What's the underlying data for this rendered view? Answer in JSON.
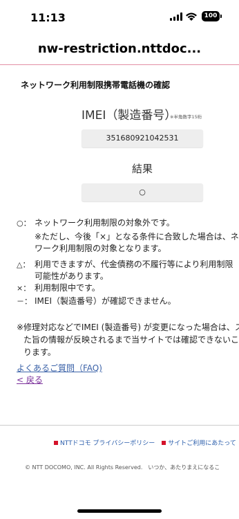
{
  "status": {
    "time": "11:13",
    "battery": "100"
  },
  "browser": {
    "url": "nw-restriction.nttdoc..."
  },
  "page": {
    "heading": "ネットワーク利用制限携帯電話機の確認",
    "imei_label": "IMEI（製造番号）",
    "imei_note": "※半角数字15桁",
    "imei_value": "351680921042531",
    "result_label": "結果",
    "result_value": "○"
  },
  "legend": {
    "circle_mark": "○：",
    "circle_text": "ネットワーク利用制限の対象外です。",
    "circle_note_1": "※ただし、今後「×」となる条件に合致した場合は、ネ",
    "circle_note_2": "ワーク利用制限の対象となります。",
    "triangle_mark": "△：",
    "triangle_text_1": "利用できますが、代金債務の不履行等により利用制限",
    "triangle_text_2": "可能性があります。",
    "cross_mark": "×：",
    "cross_text": "利用制限中です。",
    "dash_mark": "－：",
    "dash_text": "IMEI（製造番号）が確認できません。"
  },
  "notice": {
    "line_1": "※修理対応などでIMEI (製造番号) が変更になった場合は、ス",
    "line_2": "た旨の情報が反映されるまで当サイトでは確認できないこ",
    "line_3": "ります。"
  },
  "links": {
    "faq": "よくあるご質問（FAQ)",
    "back": "< 戻る"
  },
  "footer": {
    "privacy": "NTTドコモ プライバシーポリシー",
    "terms": "サイトご利用にあたって",
    "copyright": "© NTT DOCOMO, INC. All Rights Reserved.　いつか、あたりまえになるこ"
  }
}
